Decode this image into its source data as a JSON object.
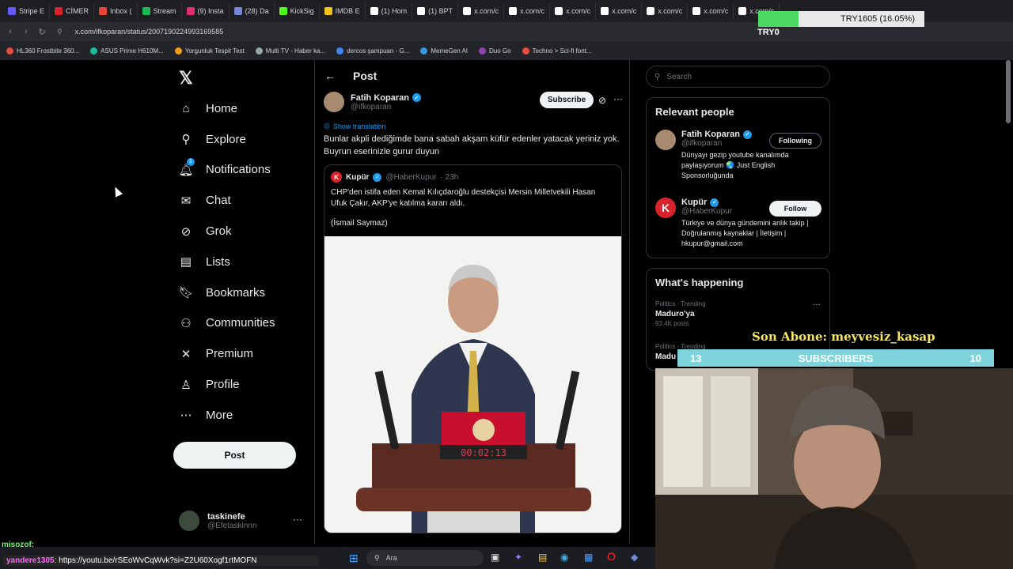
{
  "browser": {
    "tabs": [
      {
        "label": "Stripe E",
        "color": "#635bff"
      },
      {
        "label": "CİMER",
        "color": "#d8232a"
      },
      {
        "label": "Inbox (",
        "color": "#ea4335"
      },
      {
        "label": "Stream",
        "color": "#1db954"
      },
      {
        "label": "(9) Insta",
        "color": "#e1306c"
      },
      {
        "label": "(28) Da",
        "color": "#7289da"
      },
      {
        "label": "KickSig",
        "color": "#53fc18"
      },
      {
        "label": "IMDB E",
        "color": "#f5c518"
      },
      {
        "label": "(1) Hom",
        "color": "#ffffff"
      },
      {
        "label": "(1) BPT",
        "color": "#ffffff"
      },
      {
        "label": "x.com/c",
        "color": "#ffffff"
      },
      {
        "label": "x.com/c",
        "color": "#ffffff"
      },
      {
        "label": "x.com/c",
        "color": "#ffffff"
      },
      {
        "label": "x.com/c",
        "color": "#ffffff"
      },
      {
        "label": "x.com/c",
        "color": "#ffffff"
      },
      {
        "label": "x.com/c",
        "color": "#ffffff"
      },
      {
        "label": "x.com/c",
        "color": "#ffffff"
      }
    ],
    "url": "x.com/ifkoparan/status/2007190224993169585",
    "bookmarks": [
      {
        "label": "HL360 Frostbite 360...",
        "color": "#e74c3c"
      },
      {
        "label": "ASUS Prime H610M...",
        "color": "#1abc9c"
      },
      {
        "label": "Yorgunluk Tespit Test",
        "color": "#f39c12"
      },
      {
        "label": "Multi TV - Haber ka...",
        "color": "#95a5a6"
      },
      {
        "label": "dercos şampuan - G...",
        "color": "#4285f4"
      },
      {
        "label": "MemeGen AI",
        "color": "#3498db"
      },
      {
        "label": "Duo Go",
        "color": "#8e44ad"
      },
      {
        "label": "Techno > Sci-fi font...",
        "color": "#e74c3c"
      }
    ]
  },
  "nav": {
    "items": [
      {
        "label": "Home",
        "icon": "home-icon"
      },
      {
        "label": "Explore",
        "icon": "search-icon"
      },
      {
        "label": "Notifications",
        "icon": "bell-icon"
      },
      {
        "label": "Chat",
        "icon": "mail-icon"
      },
      {
        "label": "Grok",
        "icon": "grok-icon"
      },
      {
        "label": "Lists",
        "icon": "list-icon"
      },
      {
        "label": "Bookmarks",
        "icon": "bookmark-icon"
      },
      {
        "label": "Communities",
        "icon": "people-icon"
      },
      {
        "label": "Premium",
        "icon": "x-icon"
      },
      {
        "label": "Profile",
        "icon": "person-icon"
      },
      {
        "label": "More",
        "icon": "more-circle-icon"
      }
    ],
    "post_label": "Post",
    "notif_badge": "1"
  },
  "account": {
    "name": "taskinefe",
    "handle": "@Efetaskinnn"
  },
  "post": {
    "header": "Post",
    "author_name": "Fatih Koparan",
    "author_handle": "@ifkoparan",
    "subscribe_label": "Subscribe",
    "translate_label": "Show translation",
    "text": "Bunlar akpli dediğimde bana sabah akşam küfür edenler yatacak yeriniz yok. Buyrun eserinizle gurur duyun",
    "quote": {
      "name": "Kupür",
      "handle": "@HaberKupur",
      "time": "· 23h",
      "text": "CHP'den istifa eden Kemal Kılıçdaroğlu destekçisi Mersin Milletvekili Hasan Ufuk Çakır, AKP'ye katılma kararı aldı.",
      "credit": "(İsmail Saymaz)",
      "timer": "00:02:13"
    }
  },
  "search": {
    "placeholder": "Search"
  },
  "relevant": {
    "title": "Relevant people",
    "people": [
      {
        "name": "Fatih Koparan",
        "handle": "@ifkoparan",
        "button": "Following",
        "bio": "Dünyayı gezip youtube kanalımda paylaşıyorum 🌏 Just English Sponsorluğunda"
      },
      {
        "name": "Kupür",
        "handle": "@HaberKupur",
        "button": "Follow",
        "bio": "Türkiye ve dünya gündemini anlık takip | Doğrulanmış kaynaklar | İletişim | hkupur@gmail.com"
      }
    ]
  },
  "happening": {
    "title": "What's happening",
    "trends": [
      {
        "category": "Politics · Trending",
        "name": "Maduro'ya",
        "count": "93.4K posts"
      },
      {
        "category": "Politics · Trending",
        "name": "Madu",
        "count": ""
      }
    ]
  },
  "overlay": {
    "price": "TRY1605 (16.05%)",
    "price_fill": 0.16,
    "try_label": "TRY0",
    "son_abone": "Son Abone: meyvesiz_kasap",
    "subs_left": "13",
    "subs_label": "SUBSCRIBERS",
    "subs_right": "10",
    "chat1": "misozof:",
    "chat2_user": "yandere1305",
    "chat2_text": ": https://youtu.be/rSEoWvCqWvk?si=Z2U60Xogf1rtMOFN",
    "taskbar_search": "Ara"
  }
}
